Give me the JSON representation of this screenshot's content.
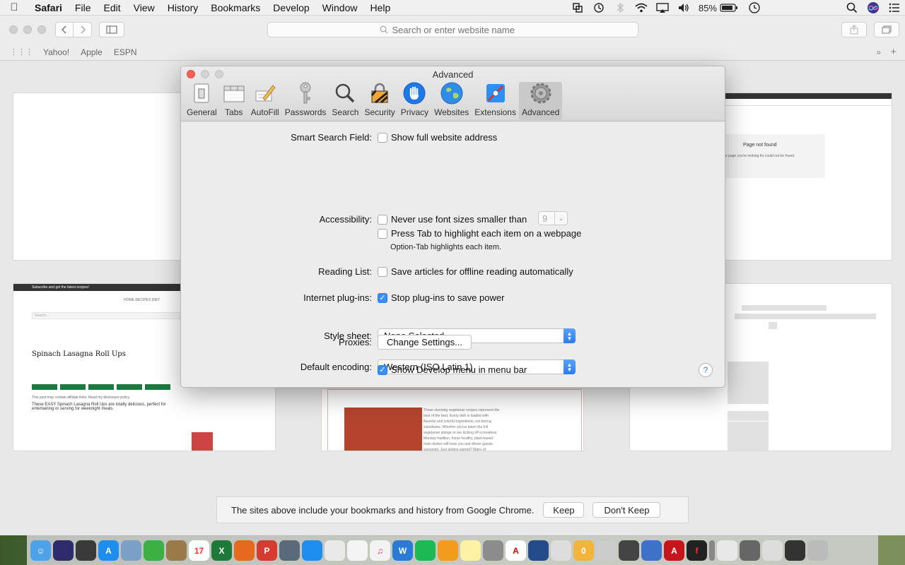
{
  "menubar": {
    "app_name": "Safari",
    "items": [
      "File",
      "Edit",
      "View",
      "History",
      "Bookmarks",
      "Develop",
      "Window",
      "Help"
    ],
    "battery": "85%"
  },
  "toolbar": {
    "search_placeholder": "Search or enter website name"
  },
  "favorites": [
    "Yahoo!",
    "Apple",
    "ESPN"
  ],
  "thumbnails": {
    "tl_notfound_title": "Page not found",
    "tl_notfound_text": "Sorry, but the page you're looking for could not be found.",
    "recipe_title": "Spinach Lasagna Roll Ups",
    "recipe_banner": "Subscribe and get the latest recipes!",
    "recipe_nav": "HOME   RECIPES   DIET",
    "recipe_search": "Search...",
    "recipe_desc": "These EASY Spinach Lasagna Roll Ups are totally delicious, perfect for entertaining or serving for weeknight meals.",
    "recipe_aff": "This post may contain affiliate links. Read my disclosure policy.",
    "center_text": "These stunning vegetarian recipes represent the best of the best. Every dish is loaded with flavorful and colorful ingredients, not boring substitutes. Whether you've taken the full vegetarian plunge or are kicking off a meatless Monday tradition, these healthy, plant-based main dishes will have you and dinner guests swooning. Just getting started? Many of"
  },
  "prefs": {
    "title": "Advanced",
    "tabs": [
      {
        "label": "General",
        "icon": "general-icon"
      },
      {
        "label": "Tabs",
        "icon": "tabs-icon"
      },
      {
        "label": "AutoFill",
        "icon": "autofill-icon"
      },
      {
        "label": "Passwords",
        "icon": "key-icon"
      },
      {
        "label": "Search",
        "icon": "magnifier-icon"
      },
      {
        "label": "Security",
        "icon": "lock-icon"
      },
      {
        "label": "Privacy",
        "icon": "hand-icon"
      },
      {
        "label": "Websites",
        "icon": "globe-icon"
      },
      {
        "label": "Extensions",
        "icon": "puzzle-icon"
      },
      {
        "label": "Advanced",
        "icon": "gear-icon"
      }
    ],
    "smart_search_label": "Smart Search Field:",
    "show_full_address": "Show full website address",
    "accessibility_label": "Accessibility:",
    "never_font_sizes": "Never use font sizes smaller than",
    "font_size_value": "9",
    "press_tab": "Press Tab to highlight each item on a webpage",
    "option_tab_note": "Option-Tab highlights each item.",
    "reading_list_label": "Reading List:",
    "save_articles": "Save articles for offline reading automatically",
    "plugins_label": "Internet plug-ins:",
    "stop_plugins": "Stop plug-ins to save power",
    "stylesheet_label": "Style sheet:",
    "stylesheet_value": "None Selected",
    "encoding_label": "Default encoding:",
    "encoding_value": "Western (ISO Latin 1)",
    "proxies_label": "Proxies:",
    "change_settings": "Change Settings...",
    "show_develop": "Show Develop menu in menu bar",
    "help": "?"
  },
  "notice": {
    "message": "The sites above include your bookmarks and history from Google Chrome.",
    "keep": "Keep",
    "dont_keep": "Don't Keep"
  },
  "colors": {
    "accent": "#3a8ef6",
    "close": "#fc605c",
    "inactive_traffic": "#d0d0d0"
  }
}
